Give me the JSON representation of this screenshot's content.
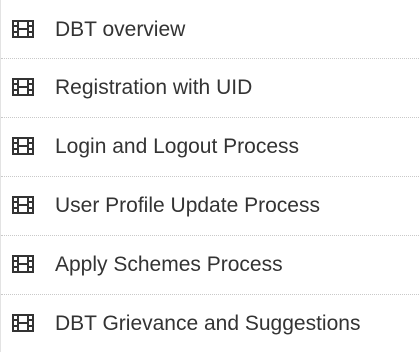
{
  "colors": {
    "text": "#333333",
    "icon": "#333333",
    "divider": "#c9c9c9",
    "border": "#e3e3e3"
  },
  "menu": {
    "items": [
      {
        "label": "DBT overview",
        "icon": "film-icon"
      },
      {
        "label": "Registration with UID",
        "icon": "film-icon"
      },
      {
        "label": "Login and Logout Process",
        "icon": "film-icon"
      },
      {
        "label": "User Profile Update Process",
        "icon": "film-icon"
      },
      {
        "label": "Apply Schemes Process",
        "icon": "film-icon"
      },
      {
        "label": "DBT Grievance and Suggestions",
        "icon": "film-icon"
      }
    ]
  }
}
